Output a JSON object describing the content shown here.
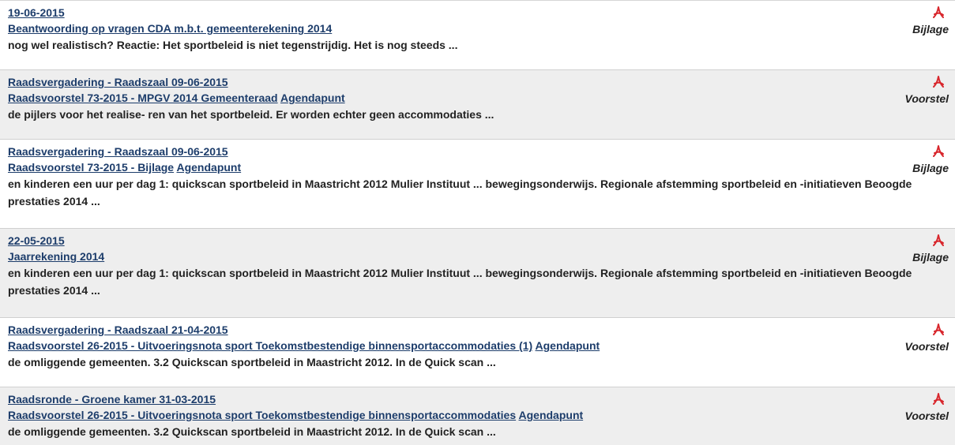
{
  "results": [
    {
      "heading": "19-06-2015",
      "title": "Beantwoording op vragen CDA m.b.t. gemeenterekening 2014",
      "link_suffix": "",
      "snippet": "nog wel realistisch? Reactie: Het sportbeleid is niet tegenstrijdig. Het is nog steeds ...",
      "doc_type": "Bijlage",
      "icon": "pdf-icon"
    },
    {
      "heading": "Raadsvergadering - Raadszaal 09-06-2015",
      "title": "Raadsvoorstel 73-2015 - MPGV 2014 Gemeenteraad",
      "link_suffix": "Agendapunt",
      "snippet": "de pijlers voor het realise- ren van het sportbeleid. Er worden echter geen accommodaties ...",
      "doc_type": "Voorstel",
      "icon": "pdf-icon"
    },
    {
      "heading": "Raadsvergadering - Raadszaal 09-06-2015",
      "title": "Raadsvoorstel 73-2015 - Bijlage",
      "link_suffix": "Agendapunt",
      "snippet": "en kinderen een uur per dag 1: quickscan sportbeleid in Maastricht 2012 Mulier Instituut ... bewegingsonderwijs. Regionale afstemming sportbeleid en -initiatieven Beoogde prestaties 2014 ...",
      "doc_type": "Bijlage",
      "icon": "pdf-icon"
    },
    {
      "heading": "22-05-2015",
      "title": "Jaarrekening 2014",
      "link_suffix": "",
      "snippet": "en kinderen een uur per dag 1: quickscan sportbeleid in Maastricht 2012 Mulier Instituut ... bewegingsonderwijs. Regionale afstemming sportbeleid en -initiatieven Beoogde prestaties 2014 ...",
      "doc_type": "Bijlage",
      "icon": "pdf-icon"
    },
    {
      "heading": "Raadsvergadering - Raadszaal 21-04-2015",
      "title": "Raadsvoorstel 26-2015 - Uitvoeringsnota sport Toekomstbestendige binnensportaccommodaties (1)",
      "link_suffix": "Agendapunt",
      "snippet": "de omliggende gemeenten. 3.2 Quickscan sportbeleid in Maastricht 2012. In de Quick scan ...",
      "doc_type": "Voorstel",
      "icon": "pdf-icon"
    },
    {
      "heading": "Raadsronde - Groene kamer 31-03-2015",
      "title": "Raadsvoorstel 26-2015 - Uitvoeringsnota sport Toekomstbestendige binnensportaccommodaties",
      "link_suffix": "Agendapunt",
      "snippet": "de omliggende gemeenten. 3.2 Quickscan sportbeleid in Maastricht 2012. In de Quick scan ...",
      "doc_type": "Voorstel",
      "icon": "pdf-icon"
    }
  ],
  "colors": {
    "link": "#1d3d6b",
    "text": "#222222",
    "row_alt_bg": "#eeeeee",
    "pdf_icon": "#d8262c"
  }
}
